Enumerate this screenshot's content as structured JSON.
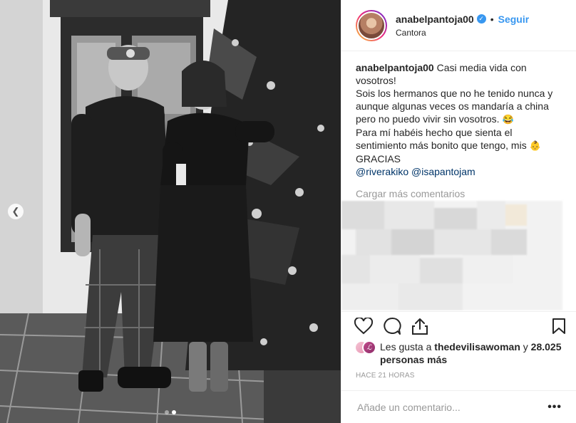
{
  "header": {
    "username": "anabelpantoja00",
    "separator": "•",
    "follow_label": "Seguir",
    "location": "Cantora",
    "verified_icon": "verified-badge-icon"
  },
  "caption": {
    "username": "anabelpantoja00",
    "line1": " Casi media vida con vosotros!",
    "line2": "Sois los hermanos que no he tenido nunca y aunque algunas veces os mandaría a china pero no puedo vivir sin vosotros. ",
    "emoji1": "😂",
    "line3": "Para mí habéis hecho que sienta el sentimiento más bonito que tengo, mis ",
    "emoji2": "👶",
    "line4": "GRACIAS",
    "mention1": "@riverakiko",
    "mention2": "@isapantojam"
  },
  "load_more_label": "Cargar más comentarios",
  "likes": {
    "prefix": "Les gusta a ",
    "user": "thedevilisawoman",
    "mid": " y ",
    "count": "28.025 personas más"
  },
  "timestamp": "HACE 21 HORAS",
  "comment_input": {
    "placeholder": "Añade un comentario..."
  },
  "more_label": "•••",
  "carousel": {
    "total": 2,
    "active": 1
  },
  "icons": [
    "heart-icon",
    "comment-icon",
    "share-icon",
    "bookmark-icon",
    "chevron-left-icon"
  ],
  "colors": {
    "link": "#3897f0",
    "mention": "#003569",
    "muted": "#999999"
  }
}
